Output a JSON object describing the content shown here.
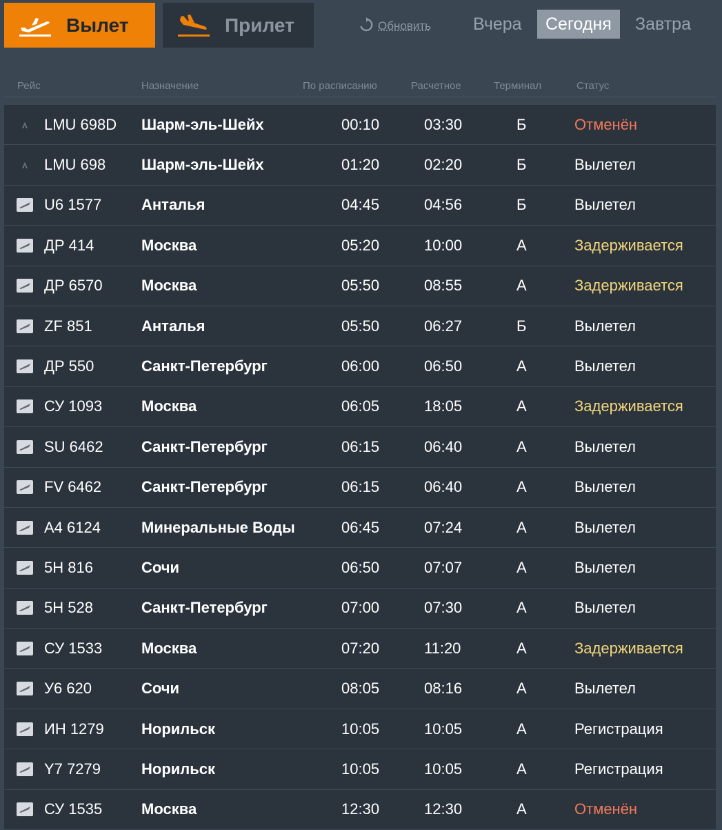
{
  "tabs": {
    "departure": "Вылет",
    "arrival": "Прилет"
  },
  "refresh_label": "Обновить",
  "days": {
    "yesterday": "Вчера",
    "today": "Сегодня",
    "tomorrow": "Завтра"
  },
  "colors": {
    "accent": "#f08107",
    "cancelled": "#f0795a",
    "delayed": "#f3d77a"
  },
  "headers": {
    "flight": "Рейс",
    "destination": "Назначение",
    "scheduled": "По расписанию",
    "estimated": "Расчетное",
    "terminal": "Терминал",
    "status": "Статус"
  },
  "flights": [
    {
      "flight": "LMU 698D",
      "destination": "Шарм-эль-Шейх",
      "scheduled": "00:10",
      "estimated": "03:30",
      "terminal": "Б",
      "status": "Отменён",
      "status_type": "cancelled",
      "logo": "airline-logo-icon"
    },
    {
      "flight": "LMU 698",
      "destination": "Шарм-эль-Шейх",
      "scheduled": "01:20",
      "estimated": "02:20",
      "terminal": "Б",
      "status": "Вылетел",
      "status_type": "normal",
      "logo": "airline-logo-icon"
    },
    {
      "flight": "U6 1577",
      "destination": "Анталья",
      "scheduled": "04:45",
      "estimated": "04:56",
      "terminal": "Б",
      "status": "Вылетел",
      "status_type": "normal",
      "logo": "airline-logo-icon"
    },
    {
      "flight": "ДР 414",
      "destination": "Москва",
      "scheduled": "05:20",
      "estimated": "10:00",
      "terminal": "А",
      "status": "Задерживается",
      "status_type": "delayed",
      "logo": "airline-logo-icon"
    },
    {
      "flight": "ДР 6570",
      "destination": "Москва",
      "scheduled": "05:50",
      "estimated": "08:55",
      "terminal": "А",
      "status": "Задерживается",
      "status_type": "delayed",
      "logo": "airline-logo-icon"
    },
    {
      "flight": "ZF 851",
      "destination": "Анталья",
      "scheduled": "05:50",
      "estimated": "06:27",
      "terminal": "Б",
      "status": "Вылетел",
      "status_type": "normal",
      "logo": "airline-logo-icon"
    },
    {
      "flight": "ДР 550",
      "destination": "Санкт-Петербург",
      "scheduled": "06:00",
      "estimated": "06:50",
      "terminal": "А",
      "status": "Вылетел",
      "status_type": "normal",
      "logo": "airline-logo-icon"
    },
    {
      "flight": "СУ 1093",
      "destination": "Москва",
      "scheduled": "06:05",
      "estimated": "18:05",
      "terminal": "А",
      "status": "Задерживается",
      "status_type": "delayed",
      "logo": "airline-logo-icon"
    },
    {
      "flight": "SU 6462",
      "destination": "Санкт-Петербург",
      "scheduled": "06:15",
      "estimated": "06:40",
      "terminal": "А",
      "status": "Вылетел",
      "status_type": "normal",
      "logo": "airline-logo-icon"
    },
    {
      "flight": "FV 6462",
      "destination": "Санкт-Петербург",
      "scheduled": "06:15",
      "estimated": "06:40",
      "terminal": "А",
      "status": "Вылетел",
      "status_type": "normal",
      "logo": "airline-logo-icon"
    },
    {
      "flight": "A4 6124",
      "destination": "Минеральные Воды",
      "scheduled": "06:45",
      "estimated": "07:24",
      "terminal": "А",
      "status": "Вылетел",
      "status_type": "normal",
      "logo": "airline-logo-icon"
    },
    {
      "flight": "5H 816",
      "destination": "Сочи",
      "scheduled": "06:50",
      "estimated": "07:07",
      "terminal": "А",
      "status": "Вылетел",
      "status_type": "normal",
      "logo": "airline-logo-icon"
    },
    {
      "flight": "5H 528",
      "destination": "Санкт-Петербург",
      "scheduled": "07:00",
      "estimated": "07:30",
      "terminal": "А",
      "status": "Вылетел",
      "status_type": "normal",
      "logo": "airline-logo-icon"
    },
    {
      "flight": "СУ 1533",
      "destination": "Москва",
      "scheduled": "07:20",
      "estimated": "11:20",
      "terminal": "А",
      "status": "Задерживается",
      "status_type": "delayed",
      "logo": "airline-logo-icon"
    },
    {
      "flight": "У6 620",
      "destination": "Сочи",
      "scheduled": "08:05",
      "estimated": "08:16",
      "terminal": "А",
      "status": "Вылетел",
      "status_type": "normal",
      "logo": "airline-logo-icon"
    },
    {
      "flight": "ИН 1279",
      "destination": "Норильск",
      "scheduled": "10:05",
      "estimated": "10:05",
      "terminal": "А",
      "status": "Регистрация",
      "status_type": "normal",
      "logo": "airline-logo-icon"
    },
    {
      "flight": "Y7 7279",
      "destination": "Норильск",
      "scheduled": "10:05",
      "estimated": "10:05",
      "terminal": "А",
      "status": "Регистрация",
      "status_type": "normal",
      "logo": "airline-logo-icon"
    },
    {
      "flight": "СУ 1535",
      "destination": "Москва",
      "scheduled": "12:30",
      "estimated": "12:30",
      "terminal": "А",
      "status": "Отменён",
      "status_type": "cancelled",
      "logo": "airline-logo-icon"
    }
  ]
}
